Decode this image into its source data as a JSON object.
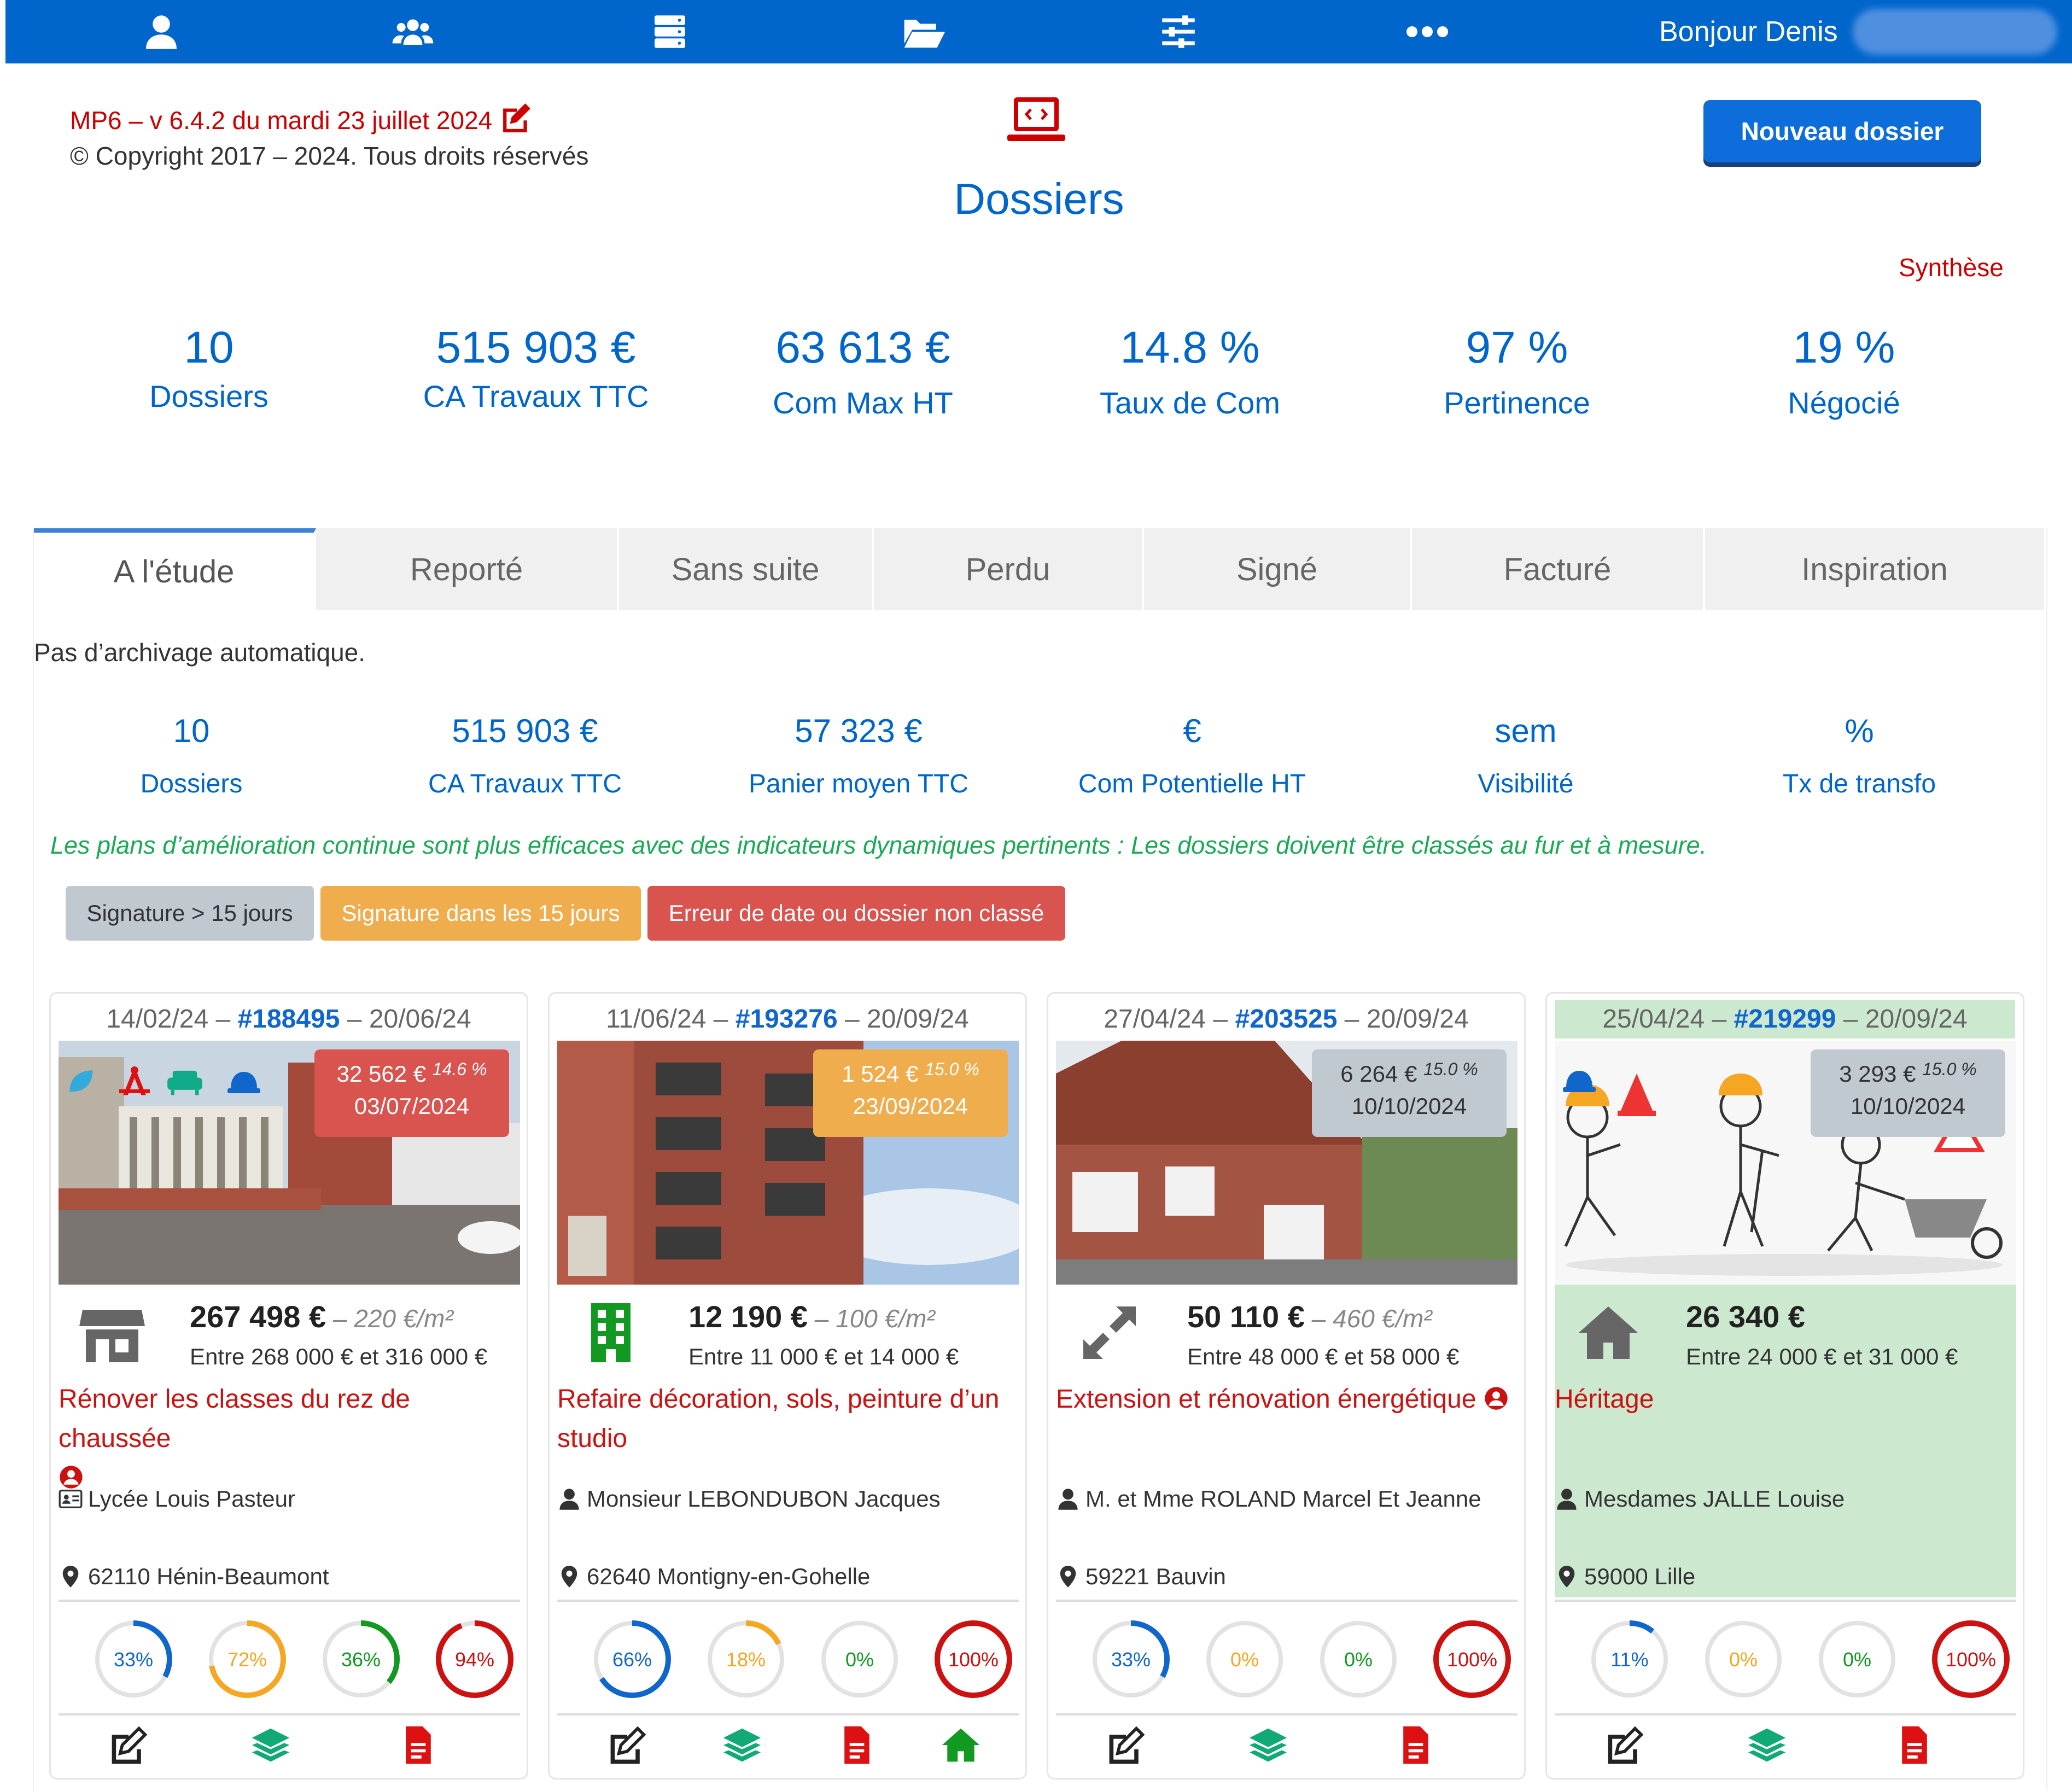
{
  "topbar": {
    "greeting": "Bonjour Denis",
    "icons": [
      "user-icon",
      "users-icon",
      "server-icon",
      "folder-open-icon",
      "sliders-icon",
      "more-icon"
    ]
  },
  "header": {
    "version": "MP6 – v 6.4.2 du mardi 23 juillet 2024",
    "copyright": "© Copyright 2017 – 2024. Tous droits réservés",
    "title": "Dossiers",
    "new_button": "Nouveau dossier",
    "synthese": "Synthèse"
  },
  "summary": [
    {
      "value": "10",
      "label": "Dossiers"
    },
    {
      "value": "515 903 €",
      "label": "CA Travaux TTC"
    },
    {
      "value": "63 613 €",
      "label": "Com Max HT"
    },
    {
      "value": "14.8 %",
      "label": "Taux de Com"
    },
    {
      "value": "97 %",
      "label": "Pertinence"
    },
    {
      "value": "19 %",
      "label": "Négocié"
    }
  ],
  "tabs": [
    "A l'étude",
    "Reporté",
    "Sans suite",
    "Perdu",
    "Signé",
    "Facturé",
    "Inspiration"
  ],
  "active_tab": "A l'étude",
  "archive_note": "Pas d’archivage automatique.",
  "tab_kpis": [
    {
      "value": "10",
      "label": "Dossiers"
    },
    {
      "value": "515 903 €",
      "label": "CA Travaux TTC"
    },
    {
      "value": "57 323 €",
      "label": "Panier moyen TTC"
    },
    {
      "value": "€",
      "label": "Com Potentielle HT"
    },
    {
      "value": "sem",
      "label": "Visibilité"
    },
    {
      "value": "%",
      "label": "Tx de transfo"
    }
  ],
  "advice": "Les plans d’amélioration continue sont plus efficaces avec des indicateurs dynamiques pertinents : Les dossiers doivent être classés au fur et à mesure.",
  "legend": [
    {
      "label": "Signature > 15 jours",
      "color": "#c0c8d0"
    },
    {
      "label": "Signature dans les 15 jours",
      "color": "#f0ad4e"
    },
    {
      "label": "Erreur de date ou dossier non classé",
      "color": "#d9534f"
    }
  ],
  "cards": [
    {
      "date_start": "14/02/24",
      "sep1": " – ",
      "number": "#188495",
      "sep2": " – ",
      "date_end": "20/06/24",
      "badge_amount": "32 562 €",
      "badge_pct": "14.6 %",
      "badge_date": "03/07/2024",
      "badge_color": "#d9534f",
      "property_icon": "shop-icon",
      "price": "267 498 €",
      "price_m2": " – 220 €/m²",
      "range": "Entre 268 000 € et 316 000 €",
      "title": "Rénover les classes du rez de chaussée",
      "client": "Lycée Louis Pasteur",
      "client_icon": "id-card-icon",
      "city": "62110 Hénin-Beaumont",
      "rings": [
        {
          "value": 33,
          "label": "33%",
          "color": "#1166cc"
        },
        {
          "value": 72,
          "label": "72%",
          "color": "#f5a623"
        },
        {
          "value": 36,
          "label": "36%",
          "color": "#119922"
        },
        {
          "value": 94,
          "label": "94%",
          "color": "#cc1111"
        }
      ],
      "actions": [
        "edit-icon",
        "layers-icon",
        "pdf-icon"
      ]
    },
    {
      "date_start": "11/06/24",
      "sep1": " – ",
      "number": "#193276",
      "sep2": " – ",
      "date_end": "20/09/24",
      "badge_amount": "1 524 €",
      "badge_pct": "15.0 %",
      "badge_date": "23/09/2024",
      "badge_color": "#f0ad4e",
      "property_icon": "building-icon",
      "price": "12 190 €",
      "price_m2": " – 100 €/m²",
      "range": "Entre 11 000 € et 14 000 €",
      "title": "Refaire décoration, sols, peinture d’un studio",
      "client": "Monsieur LEBONDUBON Jacques",
      "client_icon": "user-icon",
      "city": "62640 Montigny-en-Gohelle",
      "rings": [
        {
          "value": 66,
          "label": "66%",
          "color": "#1166cc"
        },
        {
          "value": 18,
          "label": "18%",
          "color": "#f5a623"
        },
        {
          "value": 0,
          "label": "0%",
          "color": "#119922"
        },
        {
          "value": 100,
          "label": "100%",
          "color": "#cc1111"
        }
      ],
      "actions": [
        "edit-icon",
        "layers-icon",
        "pdf-icon",
        "home-icon"
      ]
    },
    {
      "date_start": "27/04/24",
      "sep1": " – ",
      "number": "#203525",
      "sep2": " – ",
      "date_end": "20/09/24",
      "badge_amount": "6 264 €",
      "badge_pct": "15.0 %",
      "badge_date": "10/10/2024",
      "badge_color": "#c0c8d0",
      "property_icon": "expand-icon",
      "price": "50 110 €",
      "price_m2": " – 460 €/m²",
      "range": "Entre 48 000 € et 58 000 €",
      "title": "Extension et rénovation énergétique",
      "client": "M. et Mme ROLAND Marcel Et Jeanne",
      "client_icon": "user-icon",
      "city": "59221 Bauvin",
      "rings": [
        {
          "value": 33,
          "label": "33%",
          "color": "#1166cc"
        },
        {
          "value": 0,
          "label": "0%",
          "color": "#f5a623"
        },
        {
          "value": 0,
          "label": "0%",
          "color": "#119922"
        },
        {
          "value": 100,
          "label": "100%",
          "color": "#cc1111"
        }
      ],
      "actions": [
        "edit-icon",
        "layers-icon",
        "pdf-icon"
      ]
    },
    {
      "date_start": "25/04/24",
      "sep1": " – ",
      "number": "#219299",
      "sep2": " – ",
      "date_end": "20/09/24",
      "badge_amount": "3 293 €",
      "badge_pct": "15.0 %",
      "badge_date": "10/10/2024",
      "badge_color": "#c0c8d0",
      "property_icon": "home-icon",
      "price": "26 340 €",
      "price_m2": "",
      "range": "Entre 24 000 € et 31 000 €",
      "title": "Héritage",
      "client": "Mesdames JALLE Louise",
      "client_icon": "user-icon",
      "city": "59000 Lille",
      "rings": [
        {
          "value": 11,
          "label": "11%",
          "color": "#1166cc"
        },
        {
          "value": 0,
          "label": "0%",
          "color": "#f5a623"
        },
        {
          "value": 0,
          "label": "0%",
          "color": "#119922"
        },
        {
          "value": 100,
          "label": "100%",
          "color": "#cc1111"
        }
      ],
      "actions": [
        "edit-icon",
        "layers-icon",
        "pdf-icon"
      ]
    }
  ]
}
